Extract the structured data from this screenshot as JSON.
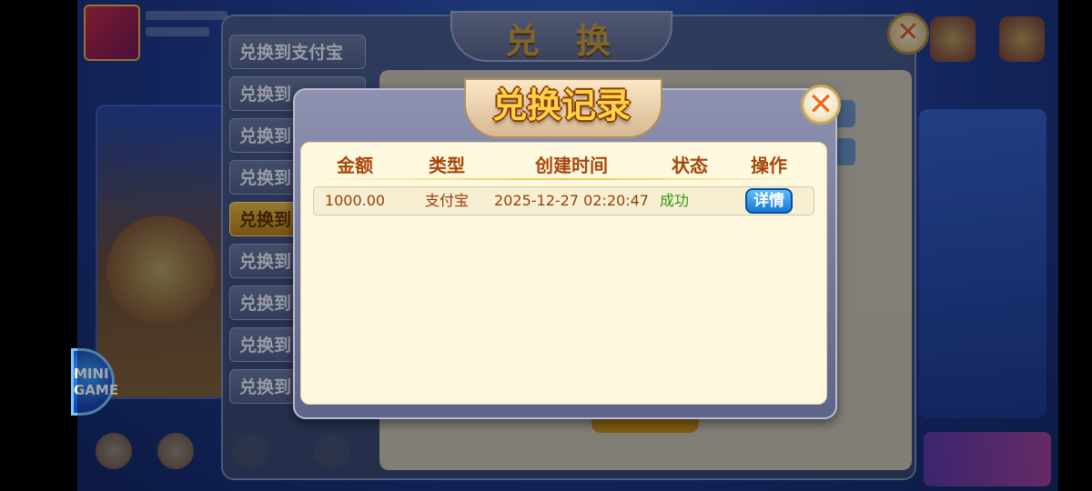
{
  "background": {
    "exchange_title": "兑换",
    "side_tabs": [
      "兑换到支付宝",
      "兑换到",
      "兑换到",
      "兑换到",
      "兑换到",
      "兑换到",
      "兑换到",
      "兑换到",
      "兑换到"
    ],
    "mini_game": "MINI GAME"
  },
  "modal": {
    "title": "兑换记录",
    "close_symbol": "✕",
    "columns": [
      "金额",
      "类型",
      "创建时间",
      "状态",
      "操作"
    ],
    "rows": [
      {
        "amount": "1000.00",
        "type": "支付宝",
        "created": "2025-12-27 02:20:47",
        "status": "成功",
        "action": "详情"
      }
    ]
  },
  "colors": {
    "header_text": "#a8460a",
    "cell_text": "#9a3c0c",
    "status_success": "#2e9a10",
    "detail_button": "#1677d6",
    "panel_bg": "#fff9df"
  }
}
